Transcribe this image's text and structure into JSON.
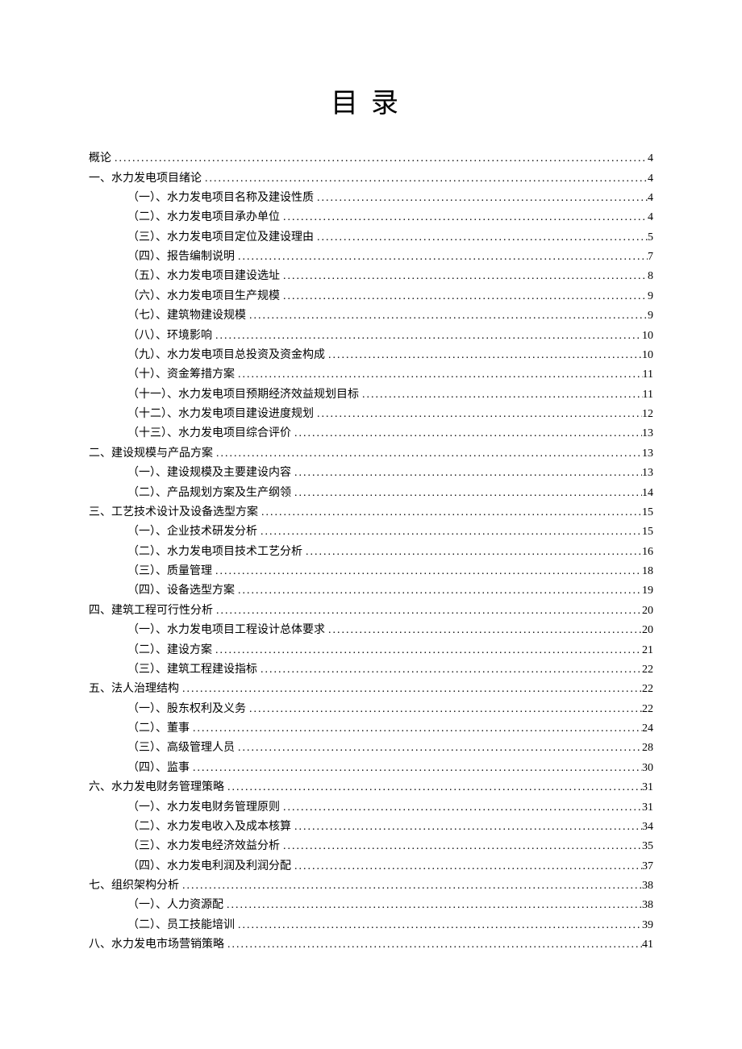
{
  "title": "目录",
  "entries": [
    {
      "level": 0,
      "label": "概论",
      "page": "4"
    },
    {
      "level": 0,
      "label": "一、水力发电项目绪论",
      "page": "4"
    },
    {
      "level": 1,
      "label": "（一）、水力发电项目名称及建设性质",
      "page": "4"
    },
    {
      "level": 1,
      "label": "（二）、水力发电项目承办单位",
      "page": "4"
    },
    {
      "level": 1,
      "label": "（三）、水力发电项目定位及建设理由",
      "page": "5"
    },
    {
      "level": 1,
      "label": "（四）、报告编制说明",
      "page": "7"
    },
    {
      "level": 1,
      "label": "（五）、水力发电项目建设选址",
      "page": "8"
    },
    {
      "level": 1,
      "label": "（六）、水力发电项目生产规模",
      "page": "9"
    },
    {
      "level": 1,
      "label": "（七）、建筑物建设规模",
      "page": "9"
    },
    {
      "level": 1,
      "label": "（八）、环境影响",
      "page": "10"
    },
    {
      "level": 1,
      "label": "（九）、水力发电项目总投资及资金构成",
      "page": "10"
    },
    {
      "level": 1,
      "label": "（十）、资金筹措方案",
      "page": "11"
    },
    {
      "level": 1,
      "label": "（十一）、水力发电项目预期经济效益规划目标",
      "page": "11"
    },
    {
      "level": 1,
      "label": "（十二）、水力发电项目建设进度规划",
      "page": "12"
    },
    {
      "level": 1,
      "label": "（十三）、水力发电项目综合评价",
      "page": "13"
    },
    {
      "level": 0,
      "label": "二、建设规模与产品方案",
      "page": "13"
    },
    {
      "level": 1,
      "label": "（一）、建设规模及主要建设内容",
      "page": "13"
    },
    {
      "level": 1,
      "label": "（二）、产品规划方案及生产纲领",
      "page": "14"
    },
    {
      "level": 0,
      "label": "三、工艺技术设计及设备选型方案",
      "page": "15"
    },
    {
      "level": 1,
      "label": "（一）、企业技术研发分析",
      "page": "15"
    },
    {
      "level": 1,
      "label": "（二）、水力发电项目技术工艺分析",
      "page": "16"
    },
    {
      "level": 1,
      "label": "（三）、质量管理",
      "page": "18"
    },
    {
      "level": 1,
      "label": "（四）、设备选型方案",
      "page": "19"
    },
    {
      "level": 0,
      "label": "四、建筑工程可行性分析",
      "page": "20"
    },
    {
      "level": 1,
      "label": "（一）、水力发电项目工程设计总体要求",
      "page": "20"
    },
    {
      "level": 1,
      "label": "（二）、建设方案",
      "page": "21"
    },
    {
      "level": 1,
      "label": "（三）、建筑工程建设指标",
      "page": "22"
    },
    {
      "level": 0,
      "label": "五、法人治理结构",
      "page": "22"
    },
    {
      "level": 1,
      "label": "（一）、股东权利及义务",
      "page": "22"
    },
    {
      "level": 1,
      "label": "（二）、董事",
      "page": "24"
    },
    {
      "level": 1,
      "label": "（三）、高级管理人员",
      "page": "28"
    },
    {
      "level": 1,
      "label": "（四）、监事",
      "page": "30"
    },
    {
      "level": 0,
      "label": "六、水力发电财务管理策略",
      "page": "31"
    },
    {
      "level": 1,
      "label": "（一）、水力发电财务管理原则",
      "page": "31"
    },
    {
      "level": 1,
      "label": "（二）、水力发电收入及成本核算",
      "page": "34"
    },
    {
      "level": 1,
      "label": "（三）、水力发电经济效益分析",
      "page": "35"
    },
    {
      "level": 1,
      "label": "（四）、水力发电利润及利润分配",
      "page": "37"
    },
    {
      "level": 0,
      "label": "七、组织架构分析",
      "page": "38"
    },
    {
      "level": 1,
      "label": "（一）、人力资源配",
      "page": "38"
    },
    {
      "level": 1,
      "label": "（二）、员工技能培训",
      "page": "39"
    },
    {
      "level": 0,
      "label": "八、水力发电市场营销策略",
      "page": "41"
    }
  ]
}
